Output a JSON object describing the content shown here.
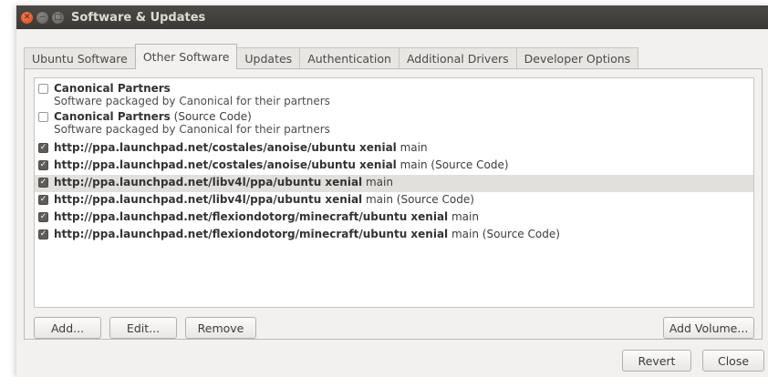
{
  "window": {
    "title": "Software & Updates"
  },
  "tabs": [
    {
      "label": "Ubuntu Software",
      "active": false
    },
    {
      "label": "Other Software",
      "active": true
    },
    {
      "label": "Updates",
      "active": false
    },
    {
      "label": "Authentication",
      "active": false
    },
    {
      "label": "Additional Drivers",
      "active": false
    },
    {
      "label": "Developer Options",
      "active": false
    }
  ],
  "sources": [
    {
      "checked": false,
      "name": "Canonical Partners",
      "suffix": "",
      "description": "Software packaged by Canonical for their partners"
    },
    {
      "checked": false,
      "name": "Canonical Partners",
      "suffix": " (Source Code)",
      "description": "Software packaged by Canonical for their partners"
    },
    {
      "checked": true,
      "name": "http://ppa.launchpad.net/costales/anoise/ubuntu xenial",
      "suffix": " main",
      "description": ""
    },
    {
      "checked": true,
      "name": "http://ppa.launchpad.net/costales/anoise/ubuntu xenial",
      "suffix": " main (Source Code)",
      "description": ""
    },
    {
      "checked": true,
      "name": "http://ppa.launchpad.net/libv4l/ppa/ubuntu xenial",
      "suffix": " main",
      "description": ""
    },
    {
      "checked": true,
      "name": "http://ppa.launchpad.net/libv4l/ppa/ubuntu xenial",
      "suffix": " main (Source Code)",
      "description": ""
    },
    {
      "checked": true,
      "name": "http://ppa.launchpad.net/flexiondotorg/minecraft/ubuntu xenial",
      "suffix": " main",
      "description": ""
    },
    {
      "checked": true,
      "name": "http://ppa.launchpad.net/flexiondotorg/minecraft/ubuntu xenial",
      "suffix": " main (Source Code)",
      "description": ""
    }
  ],
  "selected_source": 4,
  "panel_buttons": {
    "add": "Add...",
    "edit": "Edit...",
    "remove": "Remove",
    "add_volume": "Add Volume..."
  },
  "dialog_buttons": {
    "revert": "Revert",
    "close": "Close"
  },
  "icons": {
    "close": "close-icon",
    "minimize": "minimize-icon",
    "maximize": "maximize-icon",
    "check": "check-icon"
  }
}
